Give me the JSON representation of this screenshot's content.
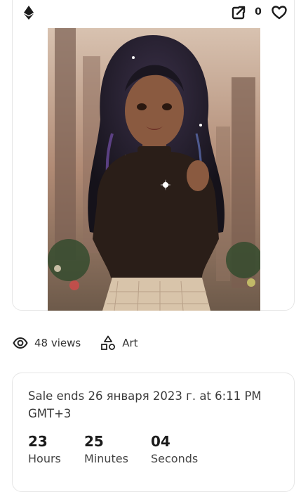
{
  "header": {
    "chain_icon": "ethereum-icon",
    "share_icon": "external-link-icon",
    "like_count": "0",
    "like_icon": "heart-icon"
  },
  "artwork": {
    "colors": {
      "background": "#b89a86",
      "hair": "#1f1a24",
      "hair_highlight": "#6a4a9a",
      "skin": "#8a5a40",
      "sweater": "#2a1e18",
      "skirt": "#d8c4aa"
    }
  },
  "stats": {
    "views_icon": "eye-icon",
    "views_label": "48 views",
    "category_icon": "shapes-icon",
    "category_label": "Art"
  },
  "sale": {
    "text": "Sale ends 26 января 2023 г. at 6:11 PM GMT+3",
    "countdown": [
      {
        "value": "23",
        "label": "Hours"
      },
      {
        "value": "25",
        "label": "Minutes"
      },
      {
        "value": "04",
        "label": "Seconds"
      }
    ]
  }
}
